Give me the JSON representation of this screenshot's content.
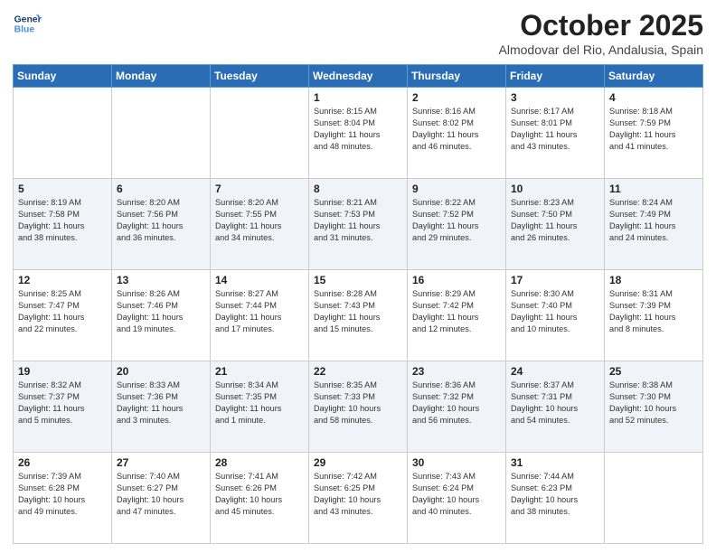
{
  "header": {
    "logo_line1": "General",
    "logo_line2": "Blue",
    "month_title": "October 2025",
    "location": "Almodovar del Rio, Andalusia, Spain"
  },
  "weekdays": [
    "Sunday",
    "Monday",
    "Tuesday",
    "Wednesday",
    "Thursday",
    "Friday",
    "Saturday"
  ],
  "weeks": [
    [
      {
        "day": "",
        "info": ""
      },
      {
        "day": "",
        "info": ""
      },
      {
        "day": "",
        "info": ""
      },
      {
        "day": "1",
        "info": "Sunrise: 8:15 AM\nSunset: 8:04 PM\nDaylight: 11 hours\nand 48 minutes."
      },
      {
        "day": "2",
        "info": "Sunrise: 8:16 AM\nSunset: 8:02 PM\nDaylight: 11 hours\nand 46 minutes."
      },
      {
        "day": "3",
        "info": "Sunrise: 8:17 AM\nSunset: 8:01 PM\nDaylight: 11 hours\nand 43 minutes."
      },
      {
        "day": "4",
        "info": "Sunrise: 8:18 AM\nSunset: 7:59 PM\nDaylight: 11 hours\nand 41 minutes."
      }
    ],
    [
      {
        "day": "5",
        "info": "Sunrise: 8:19 AM\nSunset: 7:58 PM\nDaylight: 11 hours\nand 38 minutes."
      },
      {
        "day": "6",
        "info": "Sunrise: 8:20 AM\nSunset: 7:56 PM\nDaylight: 11 hours\nand 36 minutes."
      },
      {
        "day": "7",
        "info": "Sunrise: 8:20 AM\nSunset: 7:55 PM\nDaylight: 11 hours\nand 34 minutes."
      },
      {
        "day": "8",
        "info": "Sunrise: 8:21 AM\nSunset: 7:53 PM\nDaylight: 11 hours\nand 31 minutes."
      },
      {
        "day": "9",
        "info": "Sunrise: 8:22 AM\nSunset: 7:52 PM\nDaylight: 11 hours\nand 29 minutes."
      },
      {
        "day": "10",
        "info": "Sunrise: 8:23 AM\nSunset: 7:50 PM\nDaylight: 11 hours\nand 26 minutes."
      },
      {
        "day": "11",
        "info": "Sunrise: 8:24 AM\nSunset: 7:49 PM\nDaylight: 11 hours\nand 24 minutes."
      }
    ],
    [
      {
        "day": "12",
        "info": "Sunrise: 8:25 AM\nSunset: 7:47 PM\nDaylight: 11 hours\nand 22 minutes."
      },
      {
        "day": "13",
        "info": "Sunrise: 8:26 AM\nSunset: 7:46 PM\nDaylight: 11 hours\nand 19 minutes."
      },
      {
        "day": "14",
        "info": "Sunrise: 8:27 AM\nSunset: 7:44 PM\nDaylight: 11 hours\nand 17 minutes."
      },
      {
        "day": "15",
        "info": "Sunrise: 8:28 AM\nSunset: 7:43 PM\nDaylight: 11 hours\nand 15 minutes."
      },
      {
        "day": "16",
        "info": "Sunrise: 8:29 AM\nSunset: 7:42 PM\nDaylight: 11 hours\nand 12 minutes."
      },
      {
        "day": "17",
        "info": "Sunrise: 8:30 AM\nSunset: 7:40 PM\nDaylight: 11 hours\nand 10 minutes."
      },
      {
        "day": "18",
        "info": "Sunrise: 8:31 AM\nSunset: 7:39 PM\nDaylight: 11 hours\nand 8 minutes."
      }
    ],
    [
      {
        "day": "19",
        "info": "Sunrise: 8:32 AM\nSunset: 7:37 PM\nDaylight: 11 hours\nand 5 minutes."
      },
      {
        "day": "20",
        "info": "Sunrise: 8:33 AM\nSunset: 7:36 PM\nDaylight: 11 hours\nand 3 minutes."
      },
      {
        "day": "21",
        "info": "Sunrise: 8:34 AM\nSunset: 7:35 PM\nDaylight: 11 hours\nand 1 minute."
      },
      {
        "day": "22",
        "info": "Sunrise: 8:35 AM\nSunset: 7:33 PM\nDaylight: 10 hours\nand 58 minutes."
      },
      {
        "day": "23",
        "info": "Sunrise: 8:36 AM\nSunset: 7:32 PM\nDaylight: 10 hours\nand 56 minutes."
      },
      {
        "day": "24",
        "info": "Sunrise: 8:37 AM\nSunset: 7:31 PM\nDaylight: 10 hours\nand 54 minutes."
      },
      {
        "day": "25",
        "info": "Sunrise: 8:38 AM\nSunset: 7:30 PM\nDaylight: 10 hours\nand 52 minutes."
      }
    ],
    [
      {
        "day": "26",
        "info": "Sunrise: 7:39 AM\nSunset: 6:28 PM\nDaylight: 10 hours\nand 49 minutes."
      },
      {
        "day": "27",
        "info": "Sunrise: 7:40 AM\nSunset: 6:27 PM\nDaylight: 10 hours\nand 47 minutes."
      },
      {
        "day": "28",
        "info": "Sunrise: 7:41 AM\nSunset: 6:26 PM\nDaylight: 10 hours\nand 45 minutes."
      },
      {
        "day": "29",
        "info": "Sunrise: 7:42 AM\nSunset: 6:25 PM\nDaylight: 10 hours\nand 43 minutes."
      },
      {
        "day": "30",
        "info": "Sunrise: 7:43 AM\nSunset: 6:24 PM\nDaylight: 10 hours\nand 40 minutes."
      },
      {
        "day": "31",
        "info": "Sunrise: 7:44 AM\nSunset: 6:23 PM\nDaylight: 10 hours\nand 38 minutes."
      },
      {
        "day": "",
        "info": ""
      }
    ]
  ]
}
